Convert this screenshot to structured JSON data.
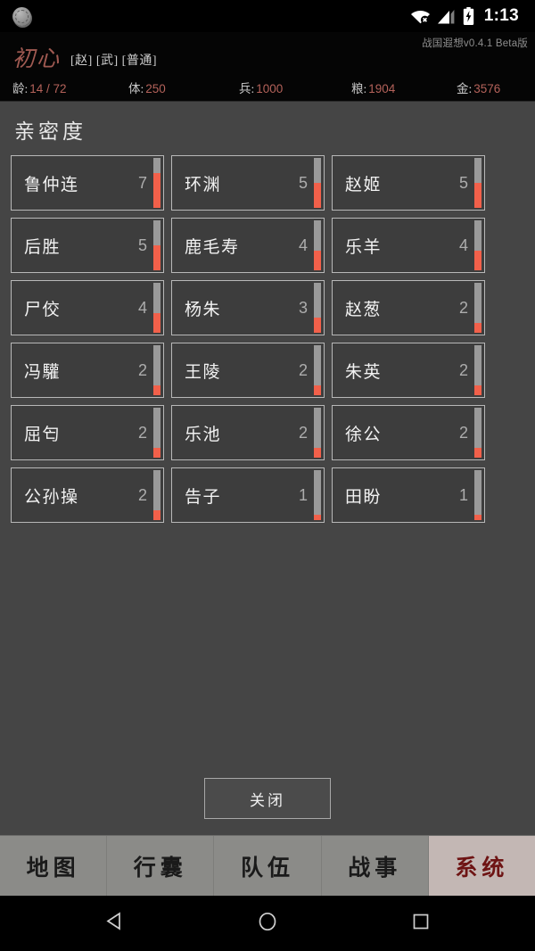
{
  "status_bar": {
    "notification_icon": "gear-circle-icon",
    "wifi_icon": "wifi-no-internet-icon",
    "signal_icon": "cellular-signal-icon",
    "battery_icon": "battery-charging-icon",
    "time": "1:13"
  },
  "header": {
    "version": "战国遐想v0.4.1 Beta版",
    "character_name": "初心",
    "tags": "[赵] [武] [普通]",
    "stats": [
      {
        "key": "龄:",
        "value": "14 / 72"
      },
      {
        "key": "体:",
        "value": "250"
      },
      {
        "key": "兵:",
        "value": "1000"
      },
      {
        "key": "粮:",
        "value": "1904"
      },
      {
        "key": "金:",
        "value": "3576"
      }
    ]
  },
  "panel": {
    "title": "亲密度",
    "max_value": 10,
    "cards": [
      {
        "name": "鲁仲连",
        "value": "7"
      },
      {
        "name": "环渊",
        "value": "5"
      },
      {
        "name": "赵姬",
        "value": "5"
      },
      {
        "name": "后胜",
        "value": "5"
      },
      {
        "name": "鹿毛寿",
        "value": "4"
      },
      {
        "name": "乐羊",
        "value": "4"
      },
      {
        "name": "尸佼",
        "value": "4"
      },
      {
        "name": "杨朱",
        "value": "3"
      },
      {
        "name": "赵葱",
        "value": "2"
      },
      {
        "name": "冯驩",
        "value": "2"
      },
      {
        "name": "王陵",
        "value": "2"
      },
      {
        "name": "朱英",
        "value": "2"
      },
      {
        "name": "屈匄",
        "value": "2"
      },
      {
        "name": "乐池",
        "value": "2"
      },
      {
        "name": "徐公",
        "value": "2"
      },
      {
        "name": "公孙操",
        "value": "2"
      },
      {
        "name": "告子",
        "value": "1"
      },
      {
        "name": "田盼",
        "value": "1"
      }
    ],
    "close_label": "关闭"
  },
  "bottom_nav": {
    "items": [
      {
        "label": "地图",
        "active": false
      },
      {
        "label": "行囊",
        "active": false
      },
      {
        "label": "队伍",
        "active": false
      },
      {
        "label": "战事",
        "active": false
      },
      {
        "label": "系统",
        "active": true
      }
    ]
  },
  "system_nav": {
    "back_icon": "triangle-back-icon",
    "home_icon": "circle-home-icon",
    "recents_icon": "square-recents-icon"
  },
  "colors": {
    "page_bg": "#454545",
    "header_bg": "#050505",
    "card_bg": "#3d3d3d",
    "card_border": "#b8b8b8",
    "gauge_track": "#9a9a9a",
    "gauge_fill": "#f2604a",
    "accent_red": "#b4625a",
    "nav_bg": "#8b8b88",
    "nav_active_bg": "#c3b7b4",
    "nav_active_text": "#6e1414"
  }
}
